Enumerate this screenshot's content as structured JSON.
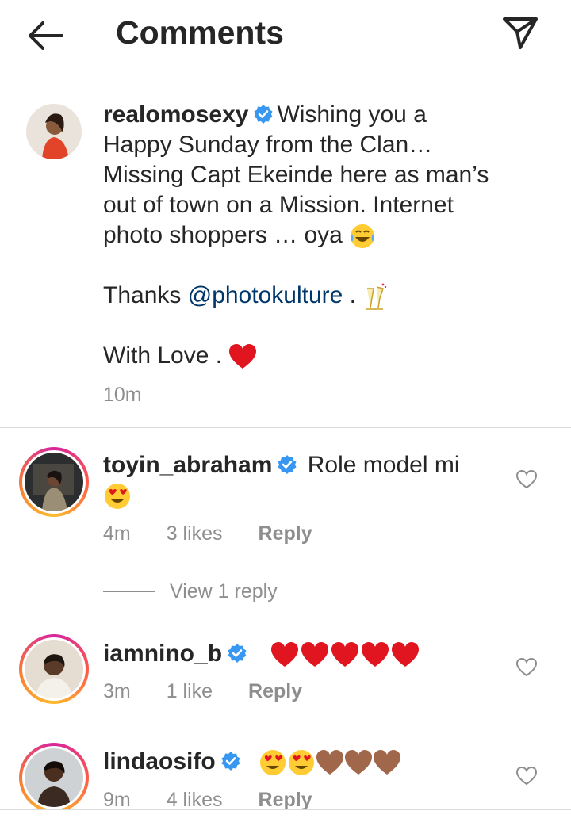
{
  "header": {
    "title": "Comments"
  },
  "caption": {
    "username": "realomosexy",
    "lines": [
      "Wishing you a",
      "Happy Sunday from the Clan…",
      "Missing Capt Ekeinde here as man’s",
      "out of town on a Mission. Internet",
      "photo shoppers … oya"
    ],
    "thanks_prefix": "Thanks",
    "mention": "@photokulture",
    "thanks_suffix": ".",
    "love": "With Love .",
    "time": "10m"
  },
  "comments": [
    {
      "username": "toyin_abraham",
      "text": "Role model mi",
      "time": "4m",
      "likes": "3 likes",
      "reply": "Reply",
      "view_replies": "View 1 reply"
    },
    {
      "username": "iamnino_b",
      "text": "",
      "time": "3m",
      "likes": "1 like",
      "reply": "Reply"
    },
    {
      "username": "lindaosifo",
      "text": "",
      "time": "9m",
      "likes": "4 likes",
      "reply": "Reply"
    }
  ],
  "colors": {
    "verified": "#3897f0",
    "mention": "#00376b",
    "heart": "#e0151f"
  }
}
